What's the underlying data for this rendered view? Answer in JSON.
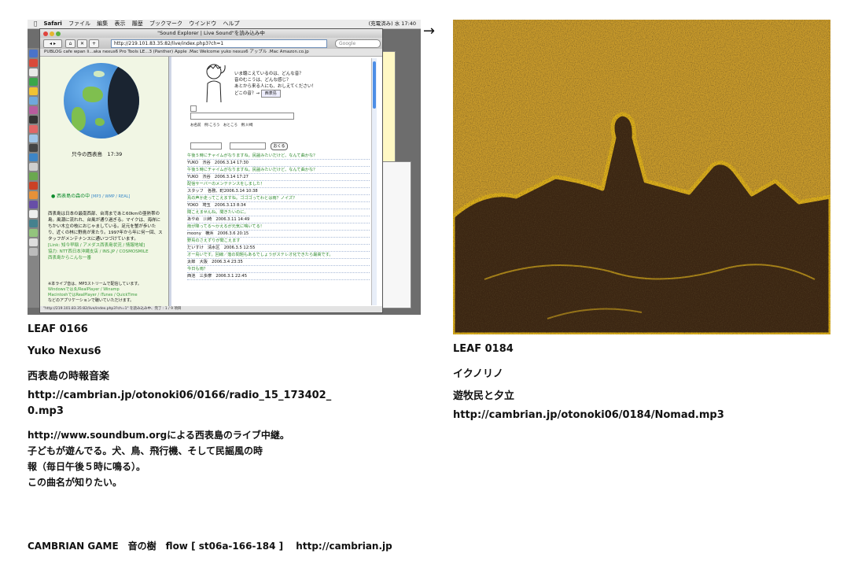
{
  "left_leaf": {
    "id": "LEAF 0166",
    "author": "Yuko Nexus6",
    "title": "西表島の時報音楽",
    "url_line1": "http://cambrian.jp/otonoki06/0166/radio_15_173402_",
    "url_line2": "0.mp3",
    "description": [
      "http://www.soundbum.orgによる西表島のライブ中継。",
      "子どもが遊んでる。犬、鳥、飛行機、そして民謡風の時",
      "報（毎日午後５時に鳴る）。",
      "この曲名が知りたい。"
    ],
    "screenshot": {
      "menubar": {
        "app": "Safari",
        "items": [
          "ファイル",
          "編集",
          "表示",
          "履歴",
          "ブックマーク",
          "ウインドウ",
          "ヘルプ"
        ],
        "status": "(充電済み)  水 17:40"
      },
      "window_title": "\"Sound Explorer | Live Sound\"を読み込み中",
      "address": "http://219.101.83.35:82/live/index.php3?ch=1",
      "search_placeholder": "Google",
      "bookmarks": "PUBLOG   cafe wpan li...aka nexus6   Pro Tools LE...3 (Panther)   Apple .Mac Welcome   yuko nexus6   アップル   .Mac   Amazon.co.jp",
      "left_panel": {
        "time_label": "只今の西表島　17:39",
        "live_label": "西表島の森の中",
        "live_note": "[MP3 / WMP / REAL]",
        "body": "西表島は日本の最南西部、台湾まであと60kmの亜熱帯の島。風潮に流れれ、台風が通り過ぎる。マイクは、海岸にちかい木立の枝におじゃましている。足元を蟹が歩いたり、近くの林に野鳥が来たり。1997年から年に何一回、スタッフがメンテナンスに通いつづけています。",
        "link_line": "[Link: 知今早稲 / アメダス西表島状況 / 情報地域]",
        "credit_line": "協力: NTT西日本沖縄支店 / INS.JP / COSMOSMILE",
        "contact": "西表島からこんな一番",
        "foot": [
          "※本ライブ音は、MP3ストリームで配信しています。",
          "Windowsではゑ/RealPlayer / Winamp",
          "MacintoshではRealPlayer / iTunes / QuickTime",
          "などのアプリケーションで聴いていただけます。"
        ]
      },
      "right_panel": {
        "question": [
          "いま聴こえているのは、どんな音？",
          "音のむこうは、どんな感じ？",
          "あとから来る人にも、おしえてください！",
          "どこの音？→"
        ],
        "selected_place": "西表島",
        "form_labels": "お名前　例:ころう　おところ　例:川崎",
        "ok_label": "おくる",
        "messages": [
          {
            "text": "午後５時にチャイムがなりますね。民謡みたいだけど、なんて曲かな？",
            "type": "t"
          },
          {
            "text": "YUKO　渋谷　2006.3.14 17:30",
            "type": "m"
          },
          {
            "text": "午後５時にチャイムがなりますね。民謡みたいだけど、なんて曲かな？",
            "type": "t"
          },
          {
            "text": "YUKO　渋谷　2006.3.14 17:27",
            "type": "m"
          },
          {
            "text": "配信サーバーのメンテナンスをしました！",
            "type": "t"
          },
          {
            "text": "スタッフ　各務、町2006.3.14 10:38",
            "type": "m"
          },
          {
            "text": "鳥の声か走ってこえますね。ゴゴゴってわとは雨？ノイズ？",
            "type": "t"
          },
          {
            "text": "YOKO　埼玉　2006.3.13 8:34",
            "type": "m"
          },
          {
            "text": "聞こえませんね。聞きたいのに。",
            "type": "t"
          },
          {
            "text": "あやめ　川崎　2006.3.11 14:49",
            "type": "m"
          },
          {
            "text": "雨が降ってる～かえるが元気に鳴いてる！",
            "type": "t"
          },
          {
            "text": "moony　横浜　2006.3.6 20:15",
            "type": "m"
          },
          {
            "text": "野鳥のさえずりが聞こえます",
            "type": "t"
          },
          {
            "text": "だいすけ　清水区　2006.3.5 12:55",
            "type": "m"
          },
          {
            "text": "オー鳥いです。回線／落の問題もあるでしょうがステレオ化できたら最高です。",
            "type": "t"
          },
          {
            "text": "太郎　大阪　2006.3.4 23:35",
            "type": "m"
          },
          {
            "text": "今日も雨？",
            "type": "t"
          },
          {
            "text": "西池　三多摩　2006.3.1 22:45",
            "type": "m"
          }
        ]
      },
      "status_bar": "\"http://219.101.83.35:82/live/index.php3?ch=1\" を読み込み中、完了 : 1 / 9 項目"
    }
  },
  "arrow": "→",
  "right_leaf": {
    "id": "LEAF 0184",
    "author": "イクノリノ",
    "title": "遊牧民と夕立",
    "url": "http://cambrian.jp/otonoki06/0184/Nomad.mp3",
    "image_colors": {
      "base": "#c99b2a",
      "dark": "#3a2512",
      "edge": "#e0b21a"
    }
  },
  "footer": "CAMBRIAN GAME　音の樹　flow [ st06a-166-184 ]　 http://cambrian.jp"
}
